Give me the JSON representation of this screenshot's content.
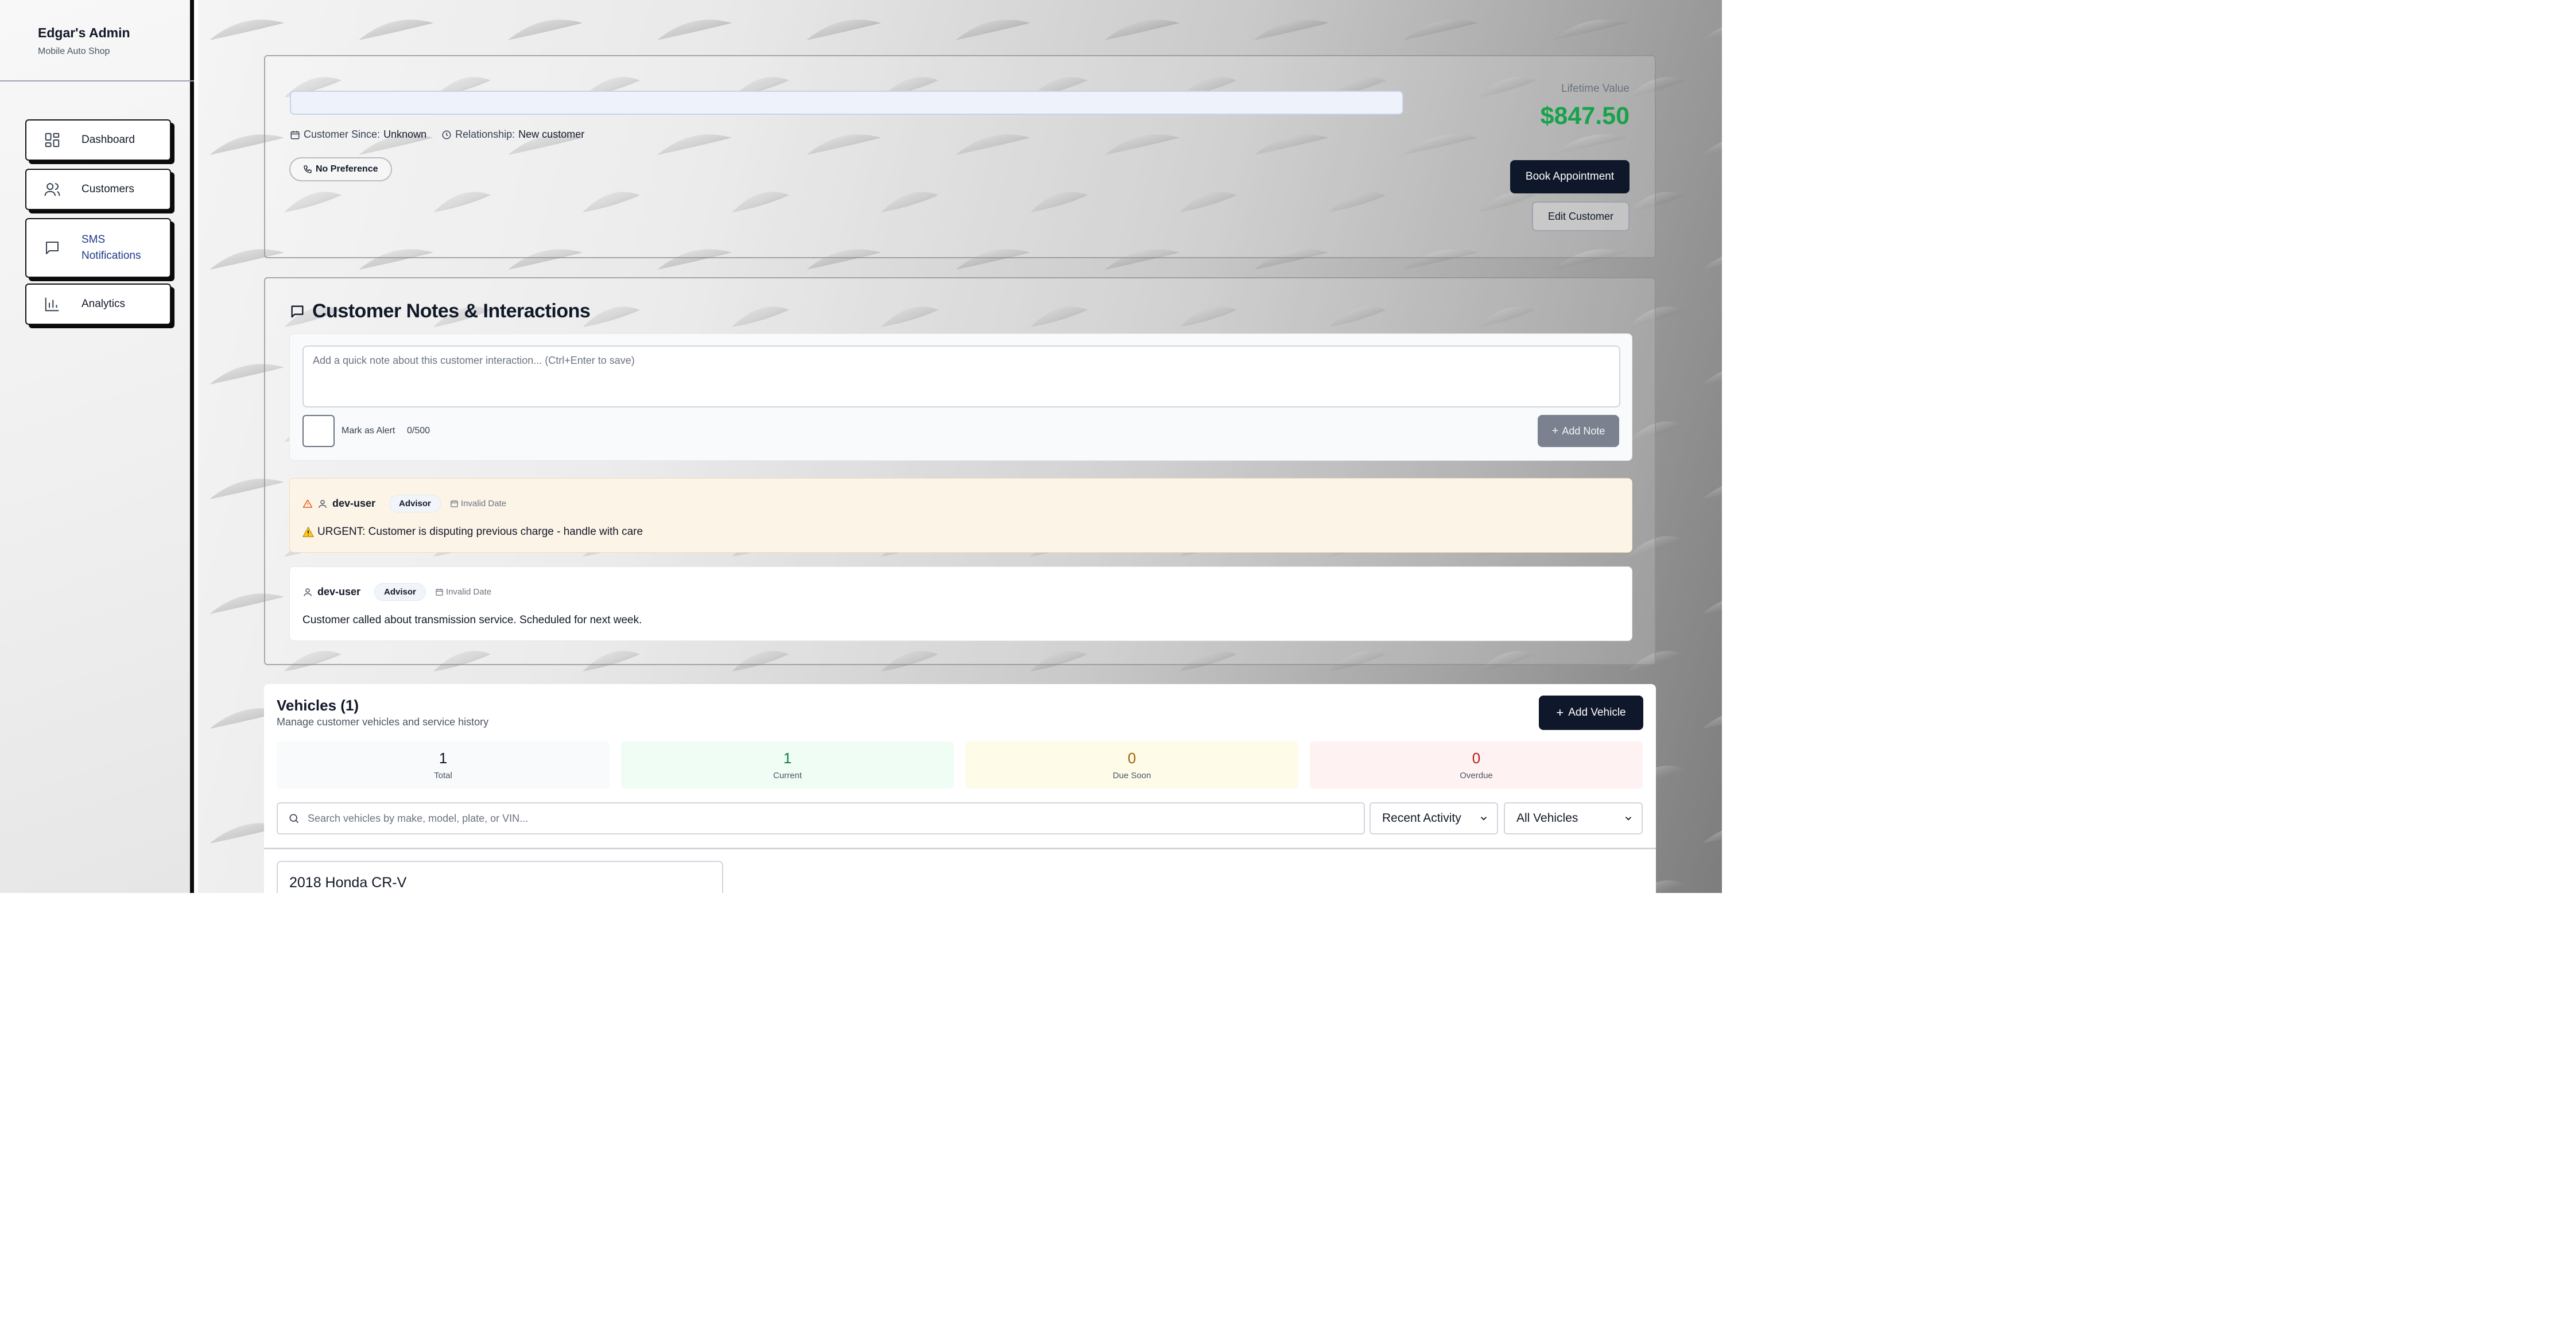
{
  "sidebar": {
    "title": "Edgar's Admin",
    "subtitle": "Mobile Auto Shop",
    "items": [
      {
        "label": "Dashboard",
        "icon": "dashboard-icon"
      },
      {
        "label": "Customers",
        "icon": "users-icon"
      },
      {
        "label": "SMS Notifications",
        "icon": "message-icon",
        "active": true
      },
      {
        "label": "Analytics",
        "icon": "bar-chart-icon"
      }
    ]
  },
  "customer": {
    "name": "",
    "since_label": "Customer Since:",
    "since_value": "Unknown",
    "relationship_label": "Relationship:",
    "relationship_value": "New customer",
    "contact_preference": "No Preference",
    "lifetime_value_label": "Lifetime Value",
    "lifetime_value": "$847.50",
    "book_button": "Book Appointment",
    "edit_button": "Edit Customer"
  },
  "notes": {
    "title": "Customer Notes & Interactions",
    "placeholder": "Add a quick note about this customer interaction... (Ctrl+Enter to save)",
    "alert_label": "Mark as Alert",
    "char_count": "0/500",
    "add_button": "Add Note",
    "items": [
      {
        "author": "dev-user",
        "role": "Advisor",
        "date": "Invalid Date",
        "text": "URGENT: Customer is disputing previous charge - handle with care",
        "alert": true
      },
      {
        "author": "dev-user",
        "role": "Advisor",
        "date": "Invalid Date",
        "text": "Customer called about transmission service. Scheduled for next week.",
        "alert": false
      }
    ]
  },
  "vehicles": {
    "title": "Vehicles (1)",
    "subtitle": "Manage customer vehicles and service history",
    "add_button": "Add Vehicle",
    "stats": [
      {
        "value": "1",
        "label": "Total",
        "color": "#111827",
        "bg": "#f8fafc"
      },
      {
        "value": "1",
        "label": "Current",
        "color": "#15803d",
        "bg": "#f0fdf4"
      },
      {
        "value": "0",
        "label": "Due Soon",
        "color": "#a16207",
        "bg": "#fefce8"
      },
      {
        "value": "0",
        "label": "Overdue",
        "color": "#b91c1c",
        "bg": "#fef2f2"
      }
    ],
    "search_placeholder": "Search vehicles by make, model, plate, or VIN...",
    "sort_selected": "Recent Activity",
    "filter_selected": "All Vehicles",
    "list": [
      {
        "name": "2018 Honda CR-V"
      }
    ]
  },
  "colors": {
    "accent_dark": "#0f172a",
    "lifetime_value": "#16a34a",
    "alert_bg": "#fdf4e8"
  }
}
